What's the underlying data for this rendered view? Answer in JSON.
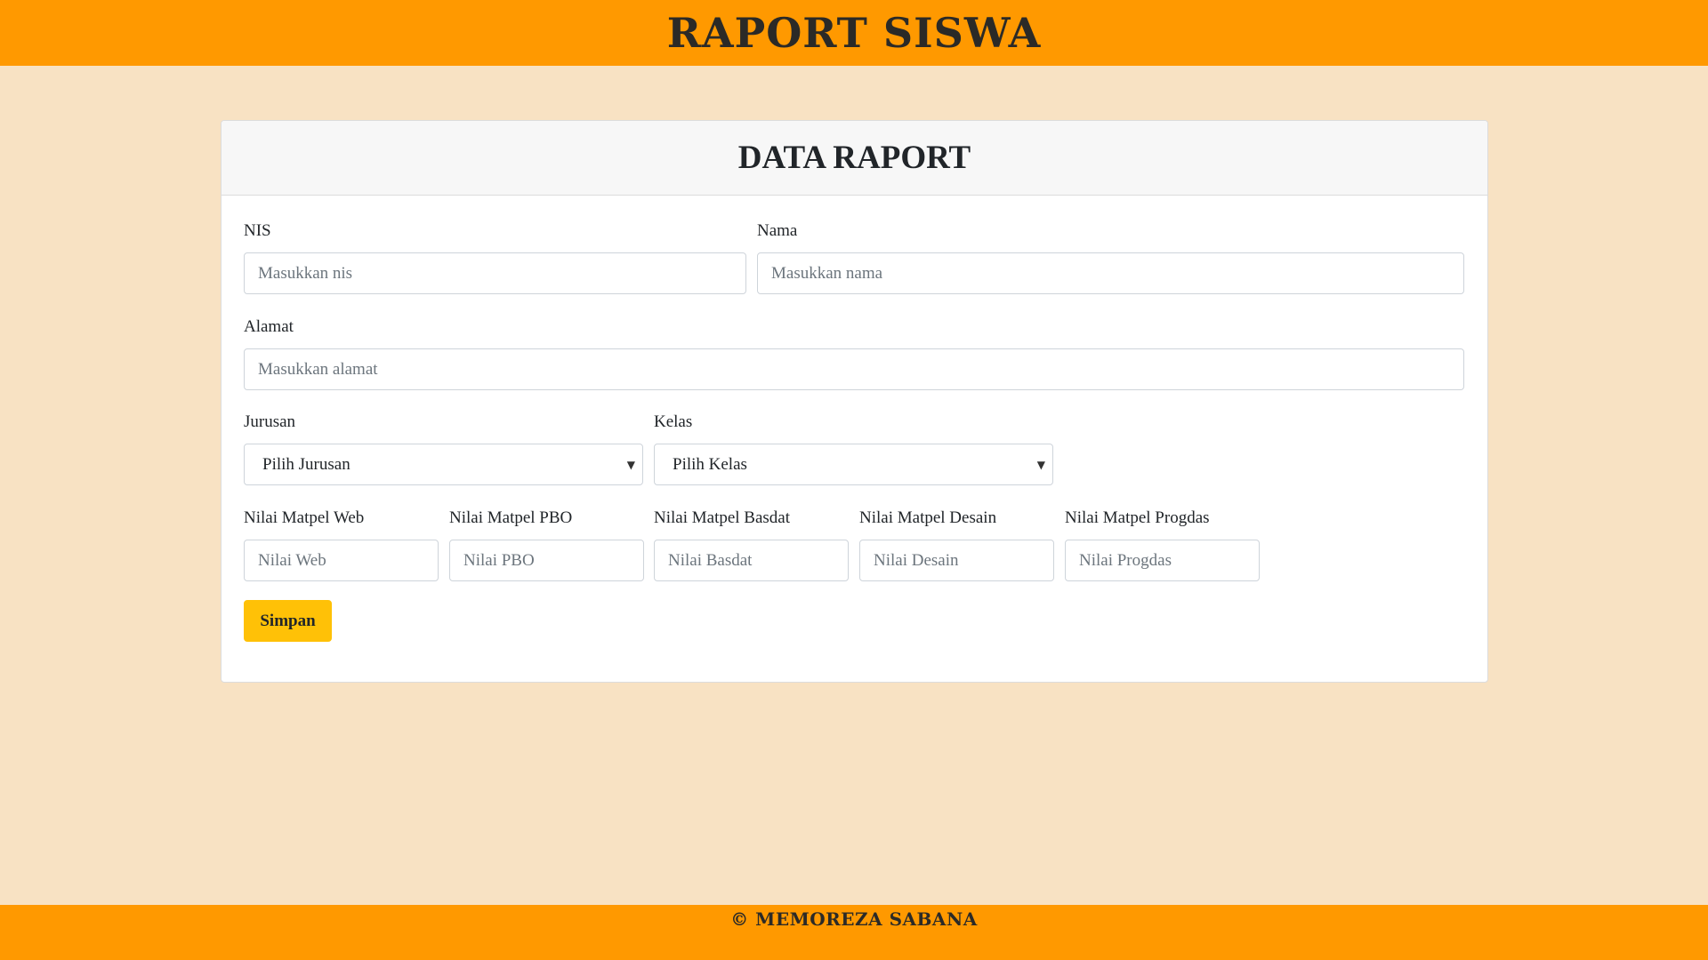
{
  "header": {
    "title": "RAPORT SISWA"
  },
  "card": {
    "title": "DATA RAPORT"
  },
  "form": {
    "nis": {
      "label": "NIS",
      "placeholder": "Masukkan nis"
    },
    "nama": {
      "label": "Nama",
      "placeholder": "Masukkan nama"
    },
    "alamat": {
      "label": "Alamat",
      "placeholder": "Masukkan alamat"
    },
    "jurusan": {
      "label": "Jurusan",
      "selected": "Pilih Jurusan"
    },
    "kelas": {
      "label": "Kelas",
      "selected": "Pilih Kelas"
    },
    "nilai": [
      {
        "label": "Nilai Matpel Web",
        "placeholder": "Nilai Web"
      },
      {
        "label": "Nilai Matpel PBO",
        "placeholder": "Nilai PBO"
      },
      {
        "label": "Nilai Matpel Basdat",
        "placeholder": "Nilai Basdat"
      },
      {
        "label": "Nilai Matpel Desain",
        "placeholder": "Nilai Desain"
      },
      {
        "label": "Nilai Matpel Progdas",
        "placeholder": "Nilai Progdas"
      }
    ],
    "submit_label": "Simpan"
  },
  "footer": {
    "text": "© MEMOREZA SABANA"
  },
  "colors": {
    "header_bg": "#ff9900",
    "page_bg": "#f8e2c3",
    "button_bg": "#ffc107"
  },
  "icons": {
    "select_caret": "caret-down-icon"
  }
}
